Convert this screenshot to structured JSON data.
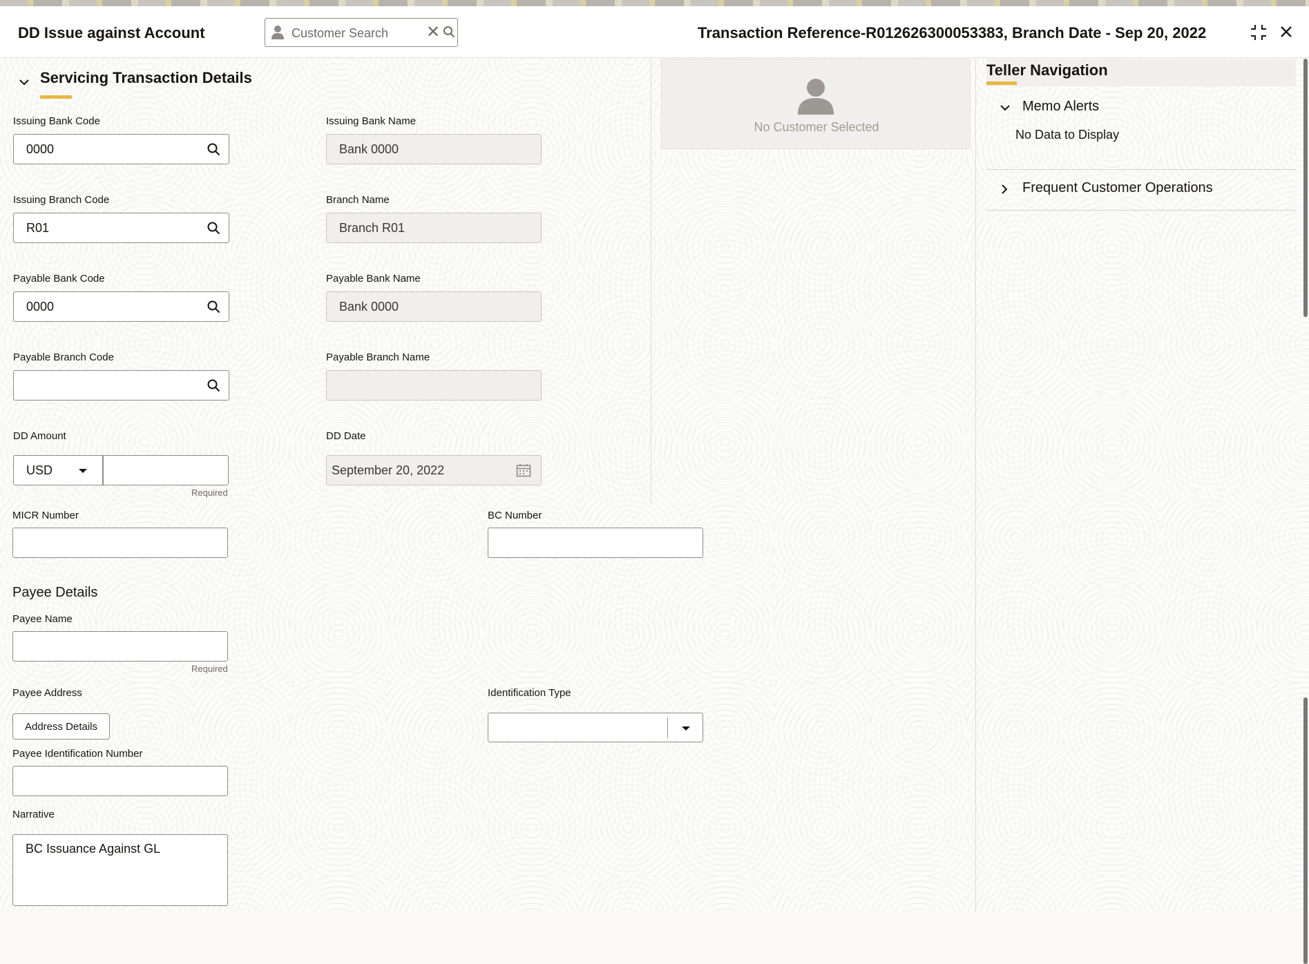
{
  "header": {
    "title": "DD Issue against Account",
    "customer_search_placeholder": "Customer Search",
    "transaction_reference": "Transaction Reference-R012626300053383, Branch Date - Sep 20, 2022"
  },
  "section": {
    "title": "Servicing Transaction Details"
  },
  "fields": {
    "issuing_bank_code": {
      "label": "Issuing Bank Code",
      "value": "0000"
    },
    "issuing_bank_name": {
      "label": "Issuing Bank Name",
      "value": "Bank 0000"
    },
    "issuing_branch_code": {
      "label": "Issuing Branch Code",
      "value": "R01"
    },
    "branch_name": {
      "label": "Branch Name",
      "value": "Branch R01"
    },
    "payable_bank_code": {
      "label": "Payable Bank Code",
      "value": "0000"
    },
    "payable_bank_name": {
      "label": "Payable Bank Name",
      "value": "Bank 0000"
    },
    "payable_branch_code": {
      "label": "Payable Branch Code",
      "value": ""
    },
    "payable_branch_name": {
      "label": "Payable Branch Name",
      "value": ""
    },
    "dd_amount": {
      "label": "DD Amount",
      "currency": "USD",
      "value": "",
      "hint": "Required"
    },
    "dd_date": {
      "label": "DD Date",
      "value": "September 20, 2022"
    },
    "micr_number": {
      "label": "MICR Number",
      "value": ""
    },
    "bc_number": {
      "label": "BC Number",
      "value": ""
    }
  },
  "payee": {
    "heading": "Payee Details",
    "name_label": "Payee Name",
    "name_value": "",
    "name_hint": "Required",
    "address_label": "Payee Address",
    "address_button": "Address Details",
    "id_type_label": "Identification Type",
    "id_type_value": "",
    "id_number_label": "Payee Identification Number",
    "id_number_value": "",
    "narrative_label": "Narrative",
    "narrative_value": "BC Issuance Against GL"
  },
  "customer_card": {
    "text": "No Customer Selected"
  },
  "teller_navigation": {
    "title": "Teller Navigation",
    "memo_alerts": "Memo Alerts",
    "no_data": "No Data to Display",
    "frequent_ops": "Frequent Customer Operations"
  },
  "colors": {
    "accent": "#e8b742",
    "readonly_bg": "#f1efed",
    "text": "#161513"
  }
}
